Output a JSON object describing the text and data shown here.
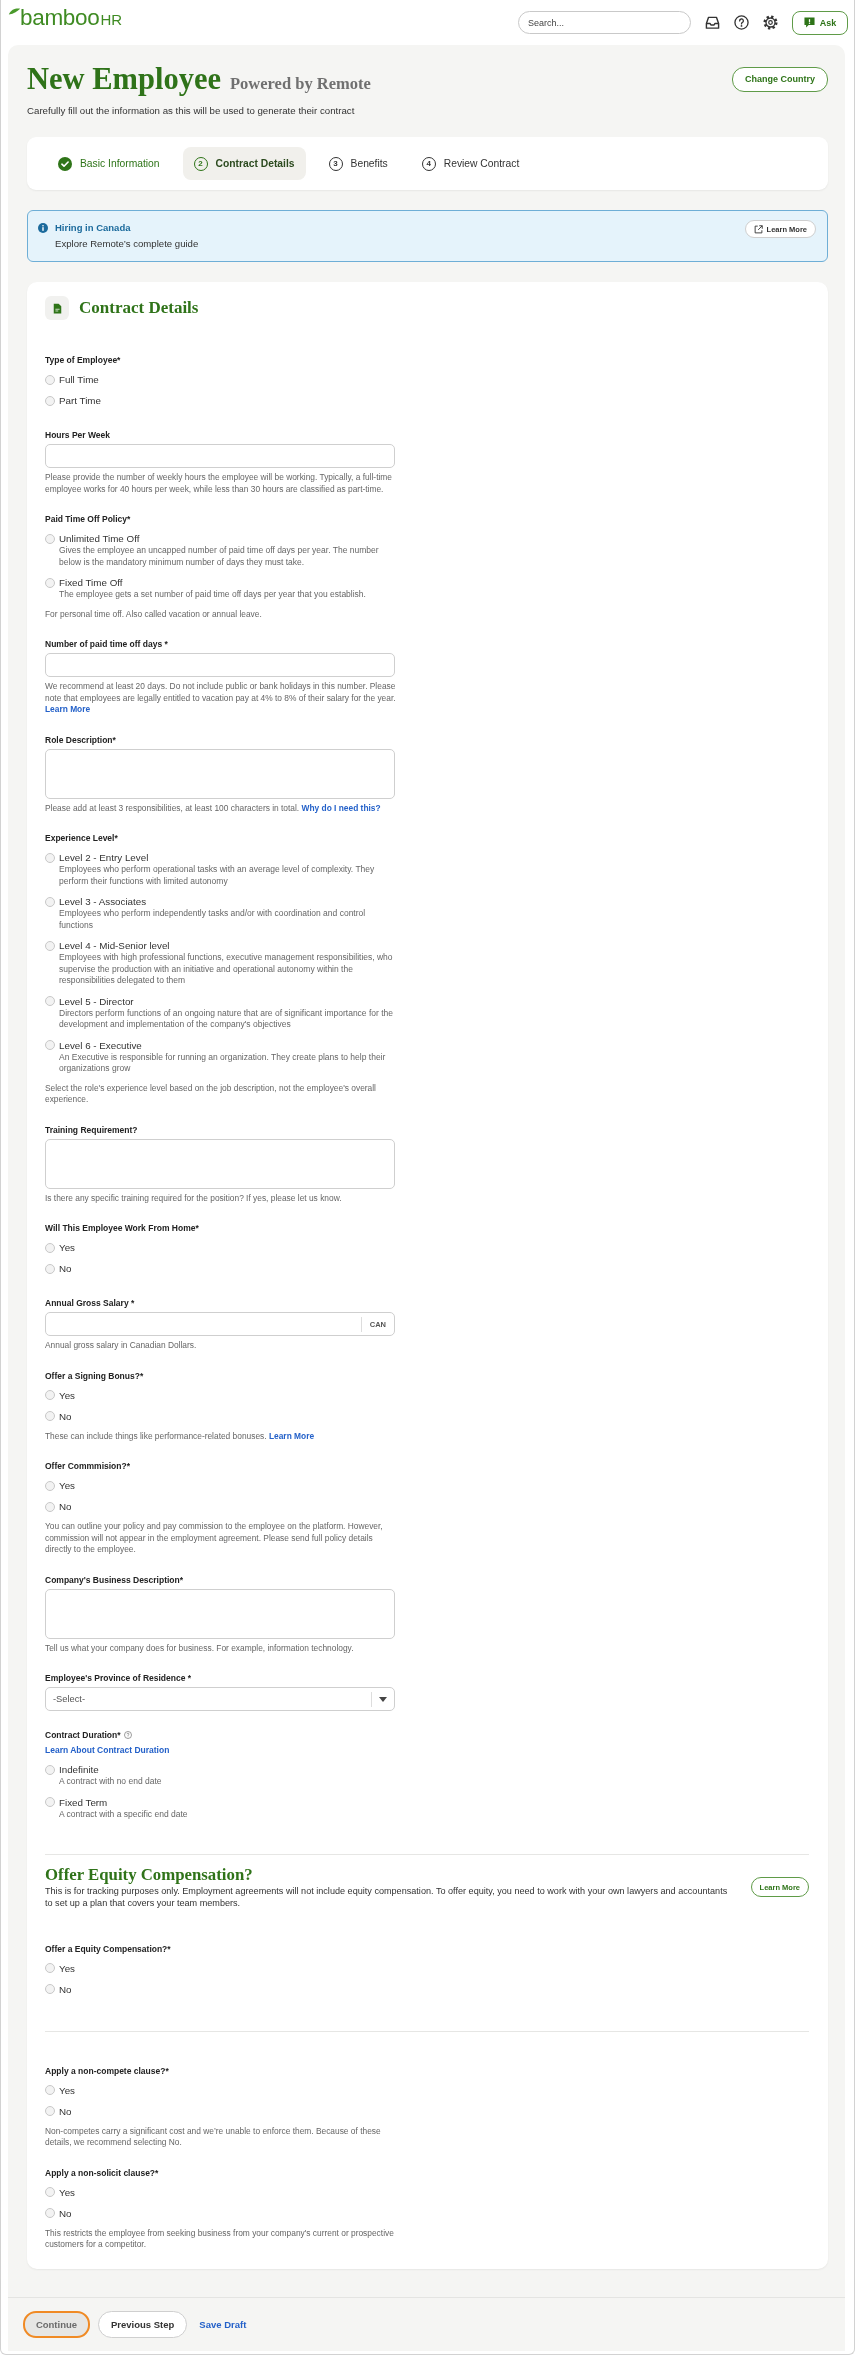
{
  "top_bar": {
    "logo": {
      "word": "bamboo",
      "suffix": "HR"
    },
    "search": {
      "placeholder": "Search..."
    },
    "ask_button": "Ask"
  },
  "header": {
    "title": "New Employee",
    "subtitle": "Powered by Remote",
    "description": "Carefully fill out the information as this will be used to generate their contract",
    "change_country_button": "Change Country"
  },
  "steps": [
    {
      "label": "Basic Information",
      "completed": true,
      "selected": false
    },
    {
      "number": "2",
      "label": "Contract Details",
      "completed": false,
      "selected": true
    },
    {
      "number": "3",
      "label": "Benefits",
      "completed": false,
      "selected": false
    },
    {
      "number": "4",
      "label": "Review Contract",
      "completed": false,
      "selected": false
    }
  ],
  "info_banner": {
    "title": "Hiring in Canada",
    "text": "Explore Remote’s complete guide",
    "button": "Learn More"
  },
  "contract_details": {
    "title": "Contract Details",
    "fields": [
      {
        "kind": "radio",
        "label": "Type of Employee*",
        "options": [
          {
            "label": "Full Time",
            "selected": false
          },
          {
            "label": "Part Time",
            "selected": false
          }
        ]
      },
      {
        "kind": "input",
        "label": "Hours Per Week",
        "help": "Please provide the number of weekly hours the employee will be working. Typically, a full-time employee works for 40 hours per week, while less than 30 hours are classified as part-time."
      },
      {
        "kind": "radio",
        "label": "Paid Time Off Policy*",
        "options": [
          {
            "label": "Unlimited Time Off",
            "description": "Gives the employee an uncapped number of paid time off days per year. The number below is the mandatory minimum number of days they must take.",
            "selected": false
          },
          {
            "label": "Fixed Time Off",
            "description": "The employee gets a set number of paid time off days per year that you establish.",
            "selected": false
          }
        ],
        "help": "For personal time off. Also called vacation or annual leave."
      },
      {
        "kind": "input",
        "label": "Number of paid time off days *",
        "help": "We recommend at least 20 days. Do not include public or bank holidays in this number. Please note that employees are legally entitled to vacation pay at 4% to 8% of their salary for the year.",
        "help_link": "Learn More"
      },
      {
        "kind": "textarea",
        "label": "Role Description*",
        "help": "Please add at least 3 responsibilities, at least 100 characters in total.",
        "help_link": "Why do I need this?"
      },
      {
        "kind": "radio",
        "label": "Experience Level*",
        "options": [
          {
            "label": "Level 2 - Entry Level",
            "description": "Employees who perform operational tasks with an average level of complexity. They perform their functions with limited autonomy",
            "selected": false
          },
          {
            "label": "Level 3 - Associates",
            "description": "Employees who perform independently tasks and/or with coordination and control functions",
            "selected": false
          },
          {
            "label": "Level 4 - Mid-Senior level",
            "description": "Employees with high professional functions, executive management responsibilities, who supervise the production with an initiative and operational autonomy within the responsibilities delegated to them",
            "selected": false
          },
          {
            "label": "Level 5 - Director",
            "description": "Directors perform functions of an ongoing nature that are of significant importance for the development and implementation of the company's objectives",
            "selected": false
          },
          {
            "label": "Level 6 - Executive",
            "description": "An Executive is responsible for running an organization. They create plans to help their organizations grow",
            "selected": false
          }
        ],
        "help": "Select the role's experience level based on the job description, not the employee's overall experience."
      },
      {
        "kind": "textarea",
        "label": "Training Requirement?",
        "help": "Is there any specific training required for the position? If yes, please let us know."
      },
      {
        "kind": "radio",
        "label": "Will This Employee Work From Home*",
        "options": [
          {
            "label": "Yes",
            "selected": false
          },
          {
            "label": "No",
            "selected": false
          }
        ]
      },
      {
        "kind": "currency_input",
        "label": "Annual Gross Salary *",
        "suffix": "CAN",
        "help": "Annual gross salary in Canadian Dollars."
      },
      {
        "kind": "radio",
        "label": "Offer a Signing Bonus?*",
        "options": [
          {
            "label": "Yes",
            "selected": false
          },
          {
            "label": "No",
            "selected": false
          }
        ],
        "help": "These can include things like performance-related bonuses.",
        "help_link": "Learn More"
      },
      {
        "kind": "radio",
        "label": "Offer Commmision?*",
        "options": [
          {
            "label": "Yes",
            "selected": false
          },
          {
            "label": "No",
            "selected": false
          }
        ],
        "help": "You can outline your policy and pay commission to the employee on the platform. However, commission will not appear in the employment agreement. Please send full policy details directly to the employee."
      },
      {
        "kind": "textarea",
        "label": "Company's Business Description*",
        "help": "Tell us what your company does for business. For example, information technology."
      },
      {
        "kind": "select",
        "label": "Employee's Province of Residence *",
        "placeholder": "-Select-"
      },
      {
        "kind": "radio",
        "label": "Contract Duration*",
        "info_icon": true,
        "link": "Learn About Contract Duration",
        "options": [
          {
            "label": "Indefinite",
            "description": "A contract with no end date",
            "selected": false
          },
          {
            "label": "Fixed Term",
            "description": "A contract with a specific end date",
            "selected": false
          }
        ]
      }
    ]
  },
  "equity": {
    "title": "Offer Equity Compensation?",
    "text": "This is for tracking purposes only. Employment agreements will not include equity compensation. To offer equity, you need to work with your own lawyers and accountants to set up a plan that covers your team members.",
    "button": "Learn More",
    "fields": [
      {
        "kind": "radio",
        "label": "Offer a Equity Compensation?*",
        "options": [
          {
            "label": "Yes",
            "selected": false
          },
          {
            "label": "No",
            "selected": false
          }
        ]
      }
    ]
  },
  "clauses": {
    "fields": [
      {
        "kind": "radio",
        "label": "Apply a non-compete clause?*",
        "options": [
          {
            "label": "Yes",
            "selected": false
          },
          {
            "label": "No",
            "selected": false
          }
        ],
        "help": "Non-competes carry a significant cost and we’re unable to enforce them. Because of these details, we recommend selecting No."
      },
      {
        "kind": "radio",
        "label": "Apply a non-solicit clause?*",
        "options": [
          {
            "label": "Yes",
            "selected": false
          },
          {
            "label": "No",
            "selected": false
          }
        ],
        "help": "This restricts the employee from seeking business from your company's current or prospective customers for a competitor."
      }
    ]
  },
  "footer": {
    "buttons": [
      {
        "kind": "primary",
        "label": "Continue",
        "disabled": true,
        "focused": true
      },
      {
        "kind": "secondary",
        "label": "Previous Step"
      },
      {
        "kind": "link",
        "label": "Save Draft"
      }
    ]
  }
}
